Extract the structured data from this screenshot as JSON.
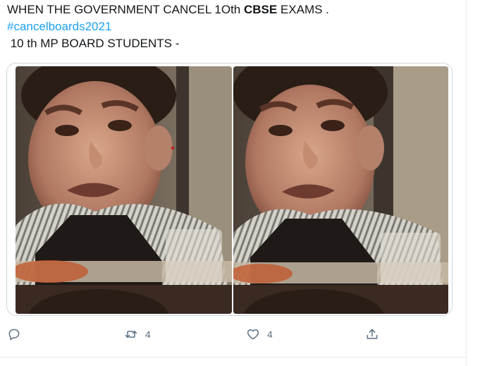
{
  "tweet": {
    "line1_before": "WHEN THE GOVERNMENT CANCEL 1Oth ",
    "line1_bold": "CBSE",
    "line1_after": " EXAMS .",
    "hashtag": "#cancelboards2021",
    "line3": " 10 th MP BOARD STUDENTS -"
  },
  "media": {
    "description": "crying-boy-meme"
  },
  "actions": {
    "reply_icon": "reply-icon",
    "retweet_icon": "retweet-icon",
    "retweet_count": "4",
    "like_icon": "heart-icon",
    "like_count": "4",
    "share_icon": "share-icon"
  },
  "colors": {
    "link": "#1da1f2",
    "icon": "#5b7083",
    "border": "#ccd6dd"
  }
}
